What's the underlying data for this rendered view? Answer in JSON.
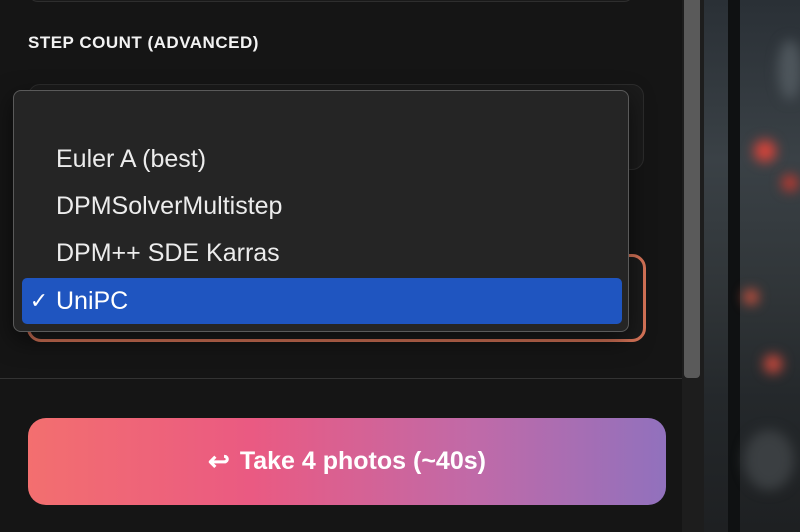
{
  "settings": {
    "step_count_label": "STEP COUNT (ADVANCED)"
  },
  "scheduler_menu": {
    "options": [
      {
        "label": "Euler A (best)",
        "selected": false
      },
      {
        "label": "DPMSolverMultistep",
        "selected": false
      },
      {
        "label": "DPM++ SDE Karras",
        "selected": false
      },
      {
        "label": "UniPC",
        "selected": true
      }
    ],
    "check_mark": "✓"
  },
  "action": {
    "return_icon": "↩",
    "take_photos_label": "Take 4 photos (~40s)"
  },
  "colors": {
    "accent_focus_border": "#d77458",
    "selected_item": "#1f55c0",
    "button_gradient_start": "#f36f6f",
    "button_gradient_end": "#9171bd"
  }
}
